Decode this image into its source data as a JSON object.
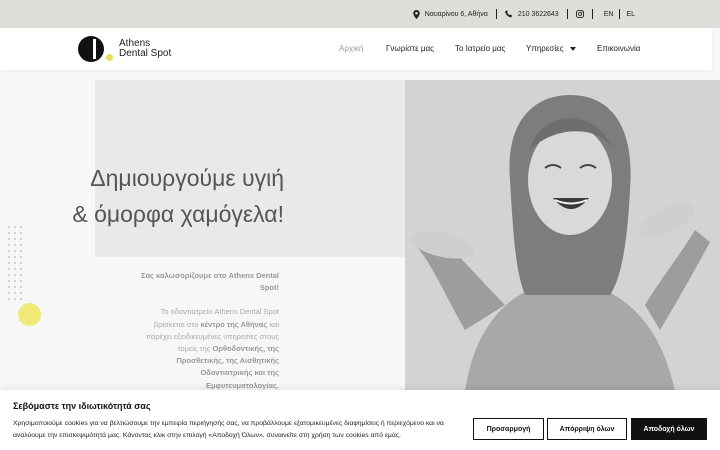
{
  "topbar": {
    "address": "Ναυαρίνου 6, Αθήνα",
    "phone": "210 3622643",
    "langs": [
      "EN",
      "EL"
    ]
  },
  "logo": {
    "line1": "Athens",
    "line2": "Dental Spot"
  },
  "nav": {
    "home": "Αρχική",
    "about": "Γνωρίστε μας",
    "clinic": "Το Ιατρείο μας",
    "services": "Υπηρεσίες",
    "contact": "Επικοινωνία"
  },
  "hero": {
    "line1": "Δημιουργούμε υγιή",
    "line2": "& όμορφα χαμόγελα!",
    "welcome": "Σας καλωσορίζουμε στο Athens Dental Spot!",
    "p_a": "Το οδοντιατρείο Athens Dental Spot βρίσκεται στο ",
    "p_b": "κέντρο της Αθήνας",
    "p_c": " και παρέχει εξειδικευμένες υπηρεσίες στους τομείς της ",
    "p_d": "Ορθοδοντικής, της Προσθετικής, της Αισθητικής Οδοντιατρικής και της Εμφυτευματολογίας."
  },
  "cookie": {
    "title": "Σεβόμαστε την ιδιωτικότητά σας",
    "text": "Χρησιμοποιούμε cookies για να βελτιώσουμε την εμπειρία περιήγησής σας, να προβάλλουμε εξατομικευμένες διαφημίσεις ή περιεχόμενο και να αναλύουμε την επισκεψιμότητά μας. Κάνοντας κλικ στην επιλογή «Αποδοχή Όλων», συναινείτε στη χρήση των cookies από εμάς.",
    "customize": "Προσαρμογή",
    "reject": "Απόρριψη όλων",
    "accept": "Αποδοχή όλων"
  }
}
